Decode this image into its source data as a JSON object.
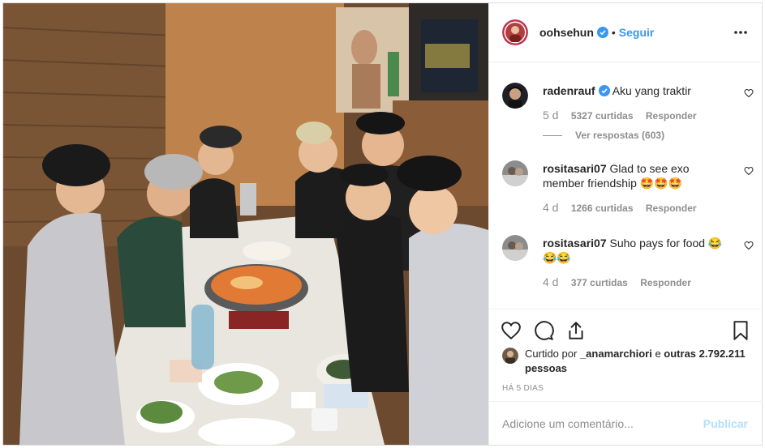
{
  "header": {
    "username": "oohsehun",
    "separator": "•",
    "follow_label": "Seguir"
  },
  "comments": [
    {
      "username": "radenrauf",
      "verified": true,
      "text": "Aku yang traktir",
      "time": "5 d",
      "likes": "5327 curtidas",
      "reply_label": "Responder",
      "view_replies": "Ver respostas (603)"
    },
    {
      "username": "rositasari07",
      "text": "Glad to see exo member friendship 🤩🤩🤩",
      "time": "4 d",
      "likes": "1266 curtidas",
      "reply_label": "Responder"
    },
    {
      "username": "rositasari07",
      "text": "Suho pays for food 😂😂😂",
      "time": "4 d",
      "likes": "377 curtidas",
      "reply_label": "Responder"
    }
  ],
  "likes": {
    "prefix": "Curtido por",
    "user": "_anamarchiori",
    "mid": "e",
    "others": "outras 2.792.211 pessoas"
  },
  "time_ago": "HÁ 5 DIAS",
  "comment_box": {
    "placeholder": "Adicione um comentário...",
    "publish_label": "Publicar"
  },
  "colors": {
    "accent": "#3897f0",
    "publish_disabled": "#b2dffc",
    "muted": "#8e8e8e",
    "border": "#efefef"
  },
  "icons": [
    "verified-badge-icon",
    "more-options-icon",
    "heart-icon",
    "comment-icon",
    "share-icon",
    "bookmark-icon"
  ]
}
